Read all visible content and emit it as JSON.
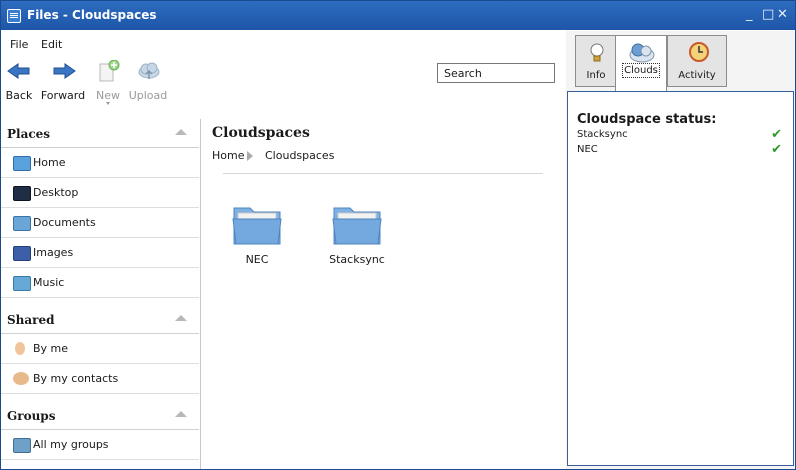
{
  "window": {
    "title": "Files - Cloudspaces",
    "controls": [
      "_",
      "□",
      "✕"
    ]
  },
  "menu": {
    "file": "File",
    "edit": "Edit"
  },
  "toolbar": {
    "back": "Back",
    "forward": "Forward",
    "new": "New",
    "upload": "Upload"
  },
  "search": {
    "value": "Search"
  },
  "places": {
    "title": "Places",
    "items": [
      {
        "label": "Home",
        "icon": "home-folder-icon"
      },
      {
        "label": "Desktop",
        "icon": "desktop-icon"
      },
      {
        "label": "Documents",
        "icon": "documents-folder-icon"
      },
      {
        "label": "Images",
        "icon": "images-folder-icon"
      },
      {
        "label": "Music",
        "icon": "music-folder-icon"
      }
    ]
  },
  "shared": {
    "title": "Shared",
    "items": [
      {
        "label": "By me",
        "icon": "person-icon"
      },
      {
        "label": "By my contacts",
        "icon": "contacts-icon"
      }
    ]
  },
  "groups": {
    "title": "Groups",
    "items": [
      {
        "label": "All my groups",
        "icon": "groups-icon"
      }
    ]
  },
  "main": {
    "title": "Cloudspaces",
    "breadcrumb": [
      "Home",
      "Cloudspaces"
    ],
    "folders": [
      {
        "name": "NEC"
      },
      {
        "name": "Stacksync"
      }
    ]
  },
  "tabs": [
    {
      "label": "Info",
      "icon": "lightbulb-icon",
      "active": false
    },
    {
      "label": "Clouds",
      "icon": "cloud-icon",
      "active": true
    },
    {
      "label": "Activity",
      "icon": "clock-icon",
      "active": false
    }
  ],
  "cloud_status": {
    "heading": "Cloudspace status:",
    "rows": [
      {
        "name": "Stacksync",
        "mark": "✔"
      },
      {
        "name": "NEC",
        "mark": "✔"
      }
    ]
  }
}
